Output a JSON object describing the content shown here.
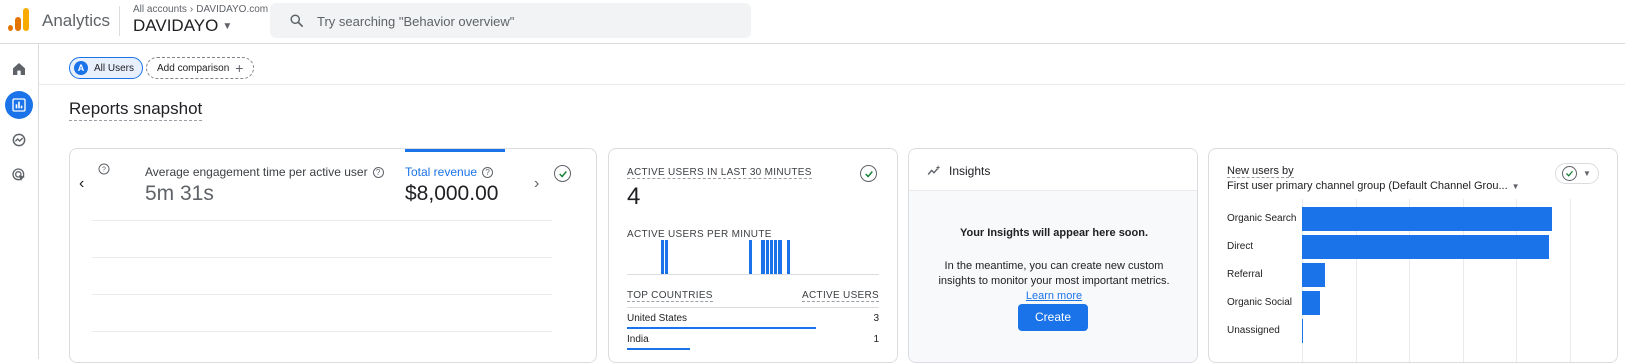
{
  "topbar": {
    "app_name": "Analytics",
    "crumb_root": "All accounts",
    "crumb_property": "DAVIDAYO.com",
    "account_name": "DAVIDAYO",
    "search_placeholder": "Try searching \"Behavior overview\""
  },
  "sidenav": {
    "items": [
      {
        "name": "home",
        "icon": "home-icon",
        "active": false
      },
      {
        "name": "reports",
        "icon": "bar-chart-icon",
        "active": true
      },
      {
        "name": "explore",
        "icon": "explore-icon",
        "active": false
      },
      {
        "name": "advertising",
        "icon": "target-cursor-icon",
        "active": false
      }
    ]
  },
  "comparison": {
    "segment_avatar": "A",
    "segment_label": "All Users",
    "add_label": "Add comparison"
  },
  "page_title": "Reports snapshot",
  "card_engagement": {
    "metric1_label": "Average engagement time per active user",
    "metric1_value": "5m 31s",
    "metric2_label": "Total revenue",
    "metric2_value": "$8,000.00"
  },
  "card_realtime": {
    "title": "ACTIVE USERS IN LAST 30 MINUTES",
    "value": "4",
    "per_minute_label": "ACTIVE USERS PER MINUTE",
    "per_minute_bars": [
      0,
      0,
      0,
      0,
      0,
      0,
      0,
      0,
      1,
      1,
      0,
      0,
      0,
      0,
      0,
      0,
      0,
      0,
      0,
      0,
      0,
      0,
      0,
      0,
      0,
      0,
      0,
      0,
      0,
      1,
      0,
      0,
      1,
      1,
      1,
      1,
      1,
      0,
      1,
      0,
      0,
      0,
      0,
      0,
      0,
      0,
      0,
      0,
      0,
      0,
      0,
      0,
      0,
      0,
      0,
      0,
      0,
      0,
      0,
      0
    ],
    "countries_header": "TOP COUNTRIES",
    "users_header": "ACTIVE USERS",
    "countries": [
      {
        "name": "United States",
        "value": "3",
        "share": 0.75
      },
      {
        "name": "India",
        "value": "1",
        "share": 0.25
      }
    ]
  },
  "card_insights": {
    "title": "Insights",
    "main_text": "Your Insights will appear here soon.",
    "desc_text": "In the meantime, you can create new custom insights to monitor your most important metrics.",
    "learn_more": "Learn more",
    "create_label": "Create"
  },
  "card_new_users": {
    "title": "New users by",
    "dimension": "First user primary channel group (Default Channel Grou...",
    "chart_data": {
      "type": "bar",
      "orientation": "horizontal",
      "categories": [
        "Organic Search",
        "Direct",
        "Referral",
        "Organic Social",
        "Unassigned"
      ],
      "values": [
        233,
        230,
        21,
        17,
        1
      ],
      "xlim": [
        0,
        250
      ],
      "grid": true
    }
  },
  "colors": {
    "accent": "#1a73e8",
    "success": "#188038"
  }
}
